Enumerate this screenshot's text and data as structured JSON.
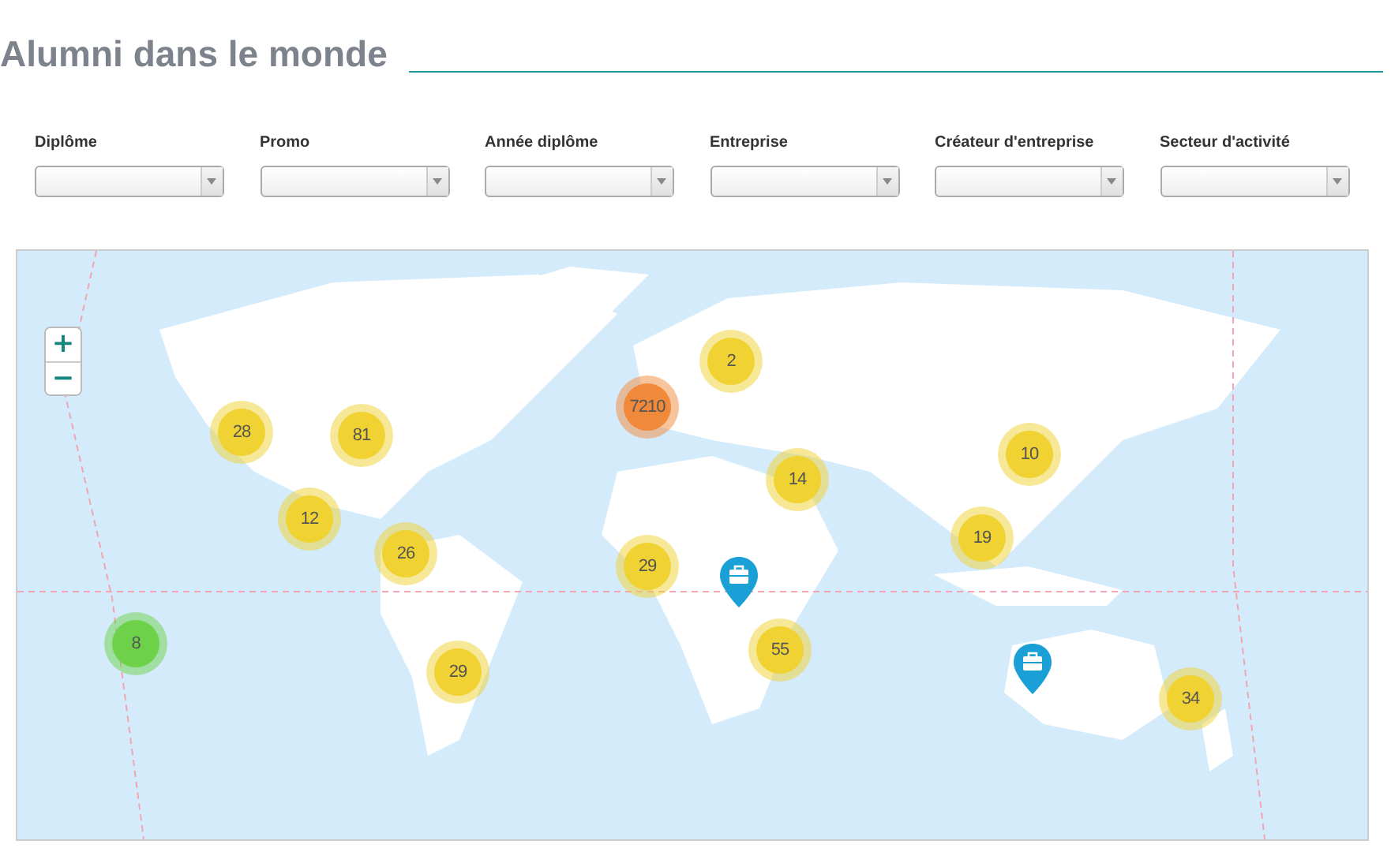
{
  "title": "Alumni dans le monde",
  "filters": [
    {
      "label": "Diplôme"
    },
    {
      "label": "Promo"
    },
    {
      "label": "Année diplôme"
    },
    {
      "label": "Entreprise"
    },
    {
      "label": "Créateur d'entreprise"
    },
    {
      "label": "Secteur d'activité"
    }
  ],
  "map": {
    "zoom_in": "+",
    "zoom_out": "−",
    "clusters": [
      {
        "count": "2",
        "color": "#f0d232"
      },
      {
        "count": "7210",
        "color": "#f1893a"
      },
      {
        "count": "28",
        "color": "#f0d232"
      },
      {
        "count": "81",
        "color": "#f0d232"
      },
      {
        "count": "10",
        "color": "#f0d232"
      },
      {
        "count": "14",
        "color": "#f0d232"
      },
      {
        "count": "12",
        "color": "#f0d232"
      },
      {
        "count": "19",
        "color": "#f0d232"
      },
      {
        "count": "26",
        "color": "#f0d232"
      },
      {
        "count": "29",
        "color": "#f0d232"
      },
      {
        "count": "8",
        "color": "#6dd24a"
      },
      {
        "count": "55",
        "color": "#f0d232"
      },
      {
        "count": "29",
        "color": "#f0d232"
      },
      {
        "count": "34",
        "color": "#f0d232"
      }
    ],
    "pins": [
      {
        "kind": "company"
      },
      {
        "kind": "company"
      }
    ]
  }
}
